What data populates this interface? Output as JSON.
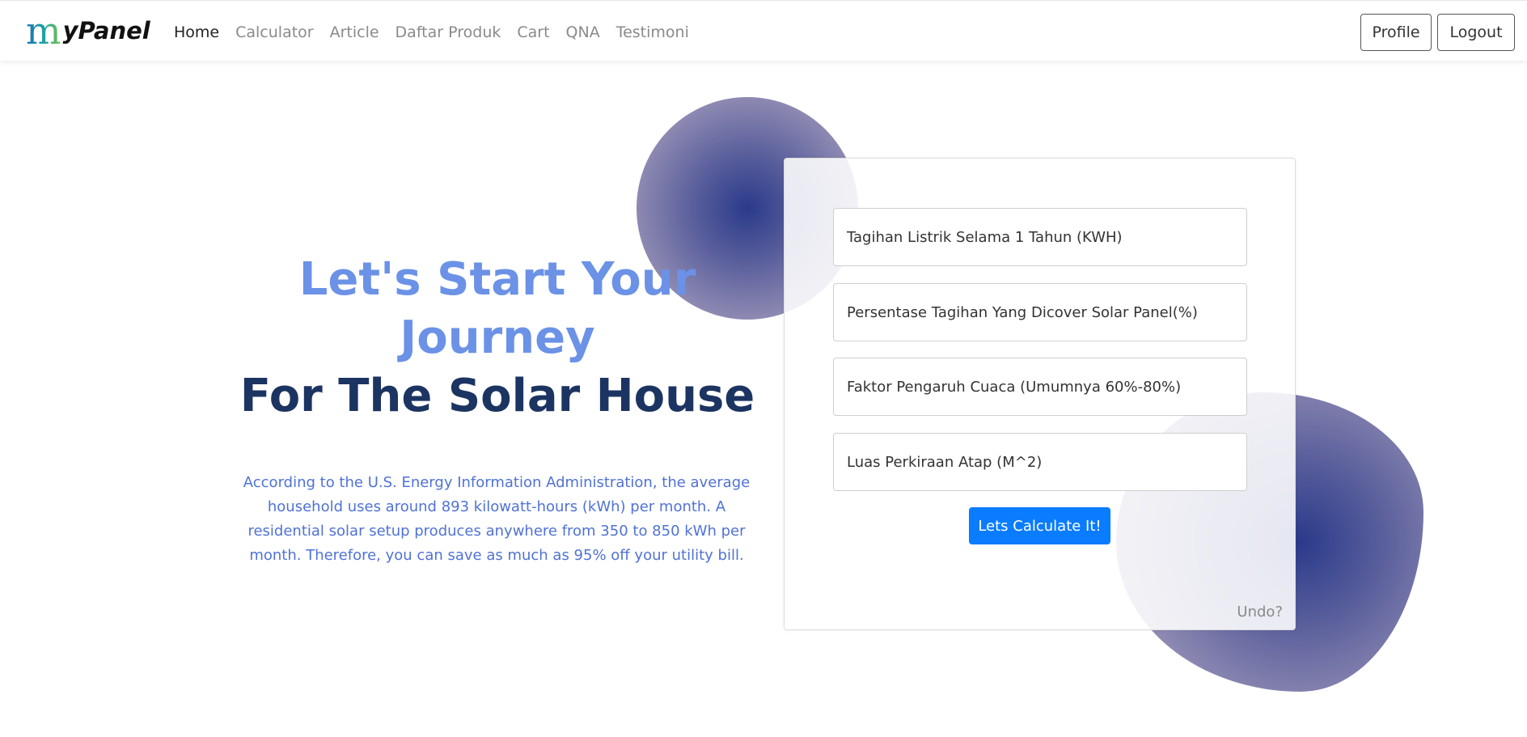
{
  "navbar": {
    "brand": {
      "first_letter": "m",
      "rest": "yPanel"
    },
    "links": [
      {
        "label": "Home",
        "active": true
      },
      {
        "label": "Calculator",
        "active": false
      },
      {
        "label": "Article",
        "active": false
      },
      {
        "label": "Daftar Produk",
        "active": false
      },
      {
        "label": "Cart",
        "active": false
      },
      {
        "label": "QNA",
        "active": false
      },
      {
        "label": "Testimoni",
        "active": false
      }
    ],
    "profile_label": "Profile",
    "logout_label": "Logout"
  },
  "hero": {
    "title_line1": "Let's Start Your Journey",
    "title_line2": "For The Solar House",
    "description": "According to the U.S. Energy Information Administration, the average household uses around 893 kilowatt-hours (kWh) per month. A residential solar setup produces anywhere from 350 to 850 kWh per month. Therefore, you can save as much as 95% off your utility bill."
  },
  "calculator": {
    "fields": [
      {
        "placeholder": "Tagihan Listrik Selama 1 Tahun (KWH)",
        "value": ""
      },
      {
        "placeholder": "Persentase Tagihan Yang Dicover Solar Panel(%)",
        "value": ""
      },
      {
        "placeholder": "Faktor Pengaruh Cuaca (Umumnya 60%-80%)",
        "value": ""
      },
      {
        "placeholder": "Luas Perkiraan Atap (M^2)",
        "value": ""
      }
    ],
    "submit_label": "Lets Calculate It!",
    "undo_label": "Undo?"
  },
  "colors": {
    "accent_blue": "#0a7cff",
    "hero_light": "#6b92e6",
    "hero_dark": "#1c3461",
    "description_text": "#5072d6"
  }
}
